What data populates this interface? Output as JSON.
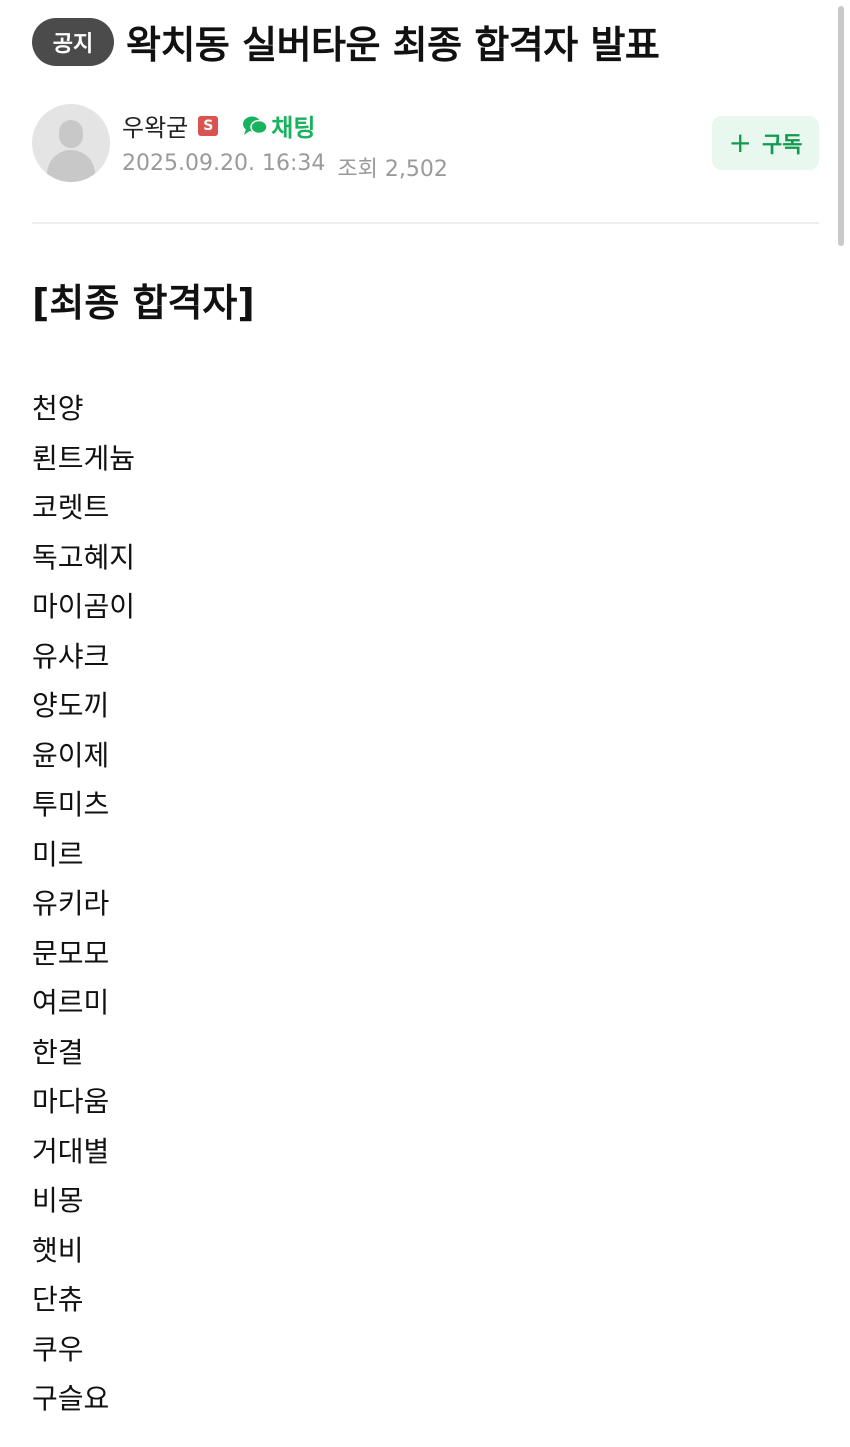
{
  "post": {
    "badge": "공지",
    "title": "왁치동 실버타운 최종 합격자 발표"
  },
  "author": {
    "name": "우왁굳",
    "staff_badge": "S",
    "chat_label": "채팅",
    "date": "2025.09.20. 16:34",
    "views": "조회 2,502"
  },
  "subscribe": {
    "label": "구독"
  },
  "content": {
    "heading": "[최종 합격자]",
    "winners": [
      "천양",
      "뢴트게늄",
      "코렛트",
      "독고혜지",
      "마이곰이",
      "유샤크",
      "양도끼",
      "윤이제",
      "투미츠",
      "미르",
      "유키라",
      "문모모",
      "여르미",
      "한결",
      "마다움",
      "거대별",
      "비몽",
      "햇비",
      "단츄",
      "쿠우",
      "구슬요"
    ]
  },
  "colors": {
    "accent_green": "#19b35f",
    "badge_bg": "#4b4b4b",
    "subscribe_bg": "#e8f8ee"
  }
}
